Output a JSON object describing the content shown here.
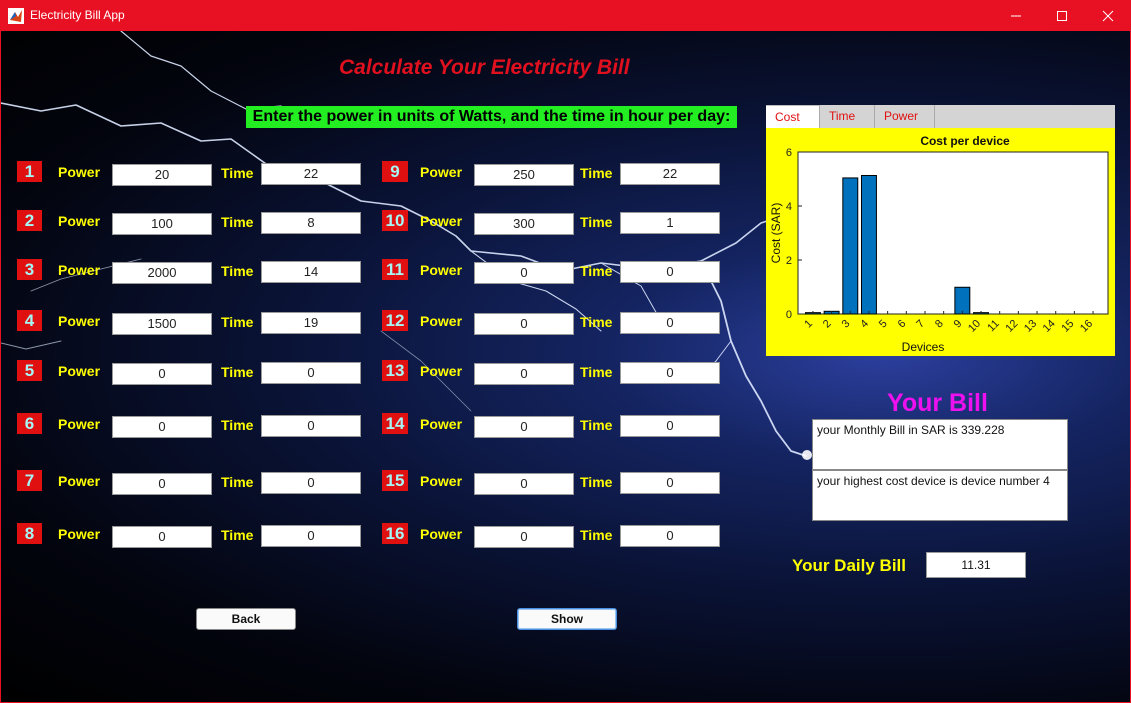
{
  "window": {
    "title": "Electricity Bill App"
  },
  "heading": "Calculate Your Electricity Bill",
  "instruction": "Enter the power in units of Watts, and the time in hour per day:",
  "labels": {
    "power": "Power",
    "time": "Time"
  },
  "devices": [
    {
      "num": "1",
      "power": "20",
      "time": "22"
    },
    {
      "num": "2",
      "power": "100",
      "time": "8"
    },
    {
      "num": "3",
      "power": "2000",
      "time": "14"
    },
    {
      "num": "4",
      "power": "1500",
      "time": "19"
    },
    {
      "num": "5",
      "power": "0",
      "time": "0"
    },
    {
      "num": "6",
      "power": "0",
      "time": "0"
    },
    {
      "num": "7",
      "power": "0",
      "time": "0"
    },
    {
      "num": "8",
      "power": "0",
      "time": "0"
    },
    {
      "num": "9",
      "power": "250",
      "time": "22"
    },
    {
      "num": "10",
      "power": "300",
      "time": "1"
    },
    {
      "num": "11",
      "power": "0",
      "time": "0"
    },
    {
      "num": "12",
      "power": "0",
      "time": "0"
    },
    {
      "num": "13",
      "power": "0",
      "time": "0"
    },
    {
      "num": "14",
      "power": "0",
      "time": "0"
    },
    {
      "num": "15",
      "power": "0",
      "time": "0"
    },
    {
      "num": "16",
      "power": "0",
      "time": "0"
    }
  ],
  "tabs": [
    "Cost",
    "Time",
    "Power"
  ],
  "chart_data": {
    "type": "bar",
    "title": "Cost per device",
    "xlabel": "Devices",
    "ylabel": "Cost (SAR)",
    "categories": [
      "1",
      "2",
      "3",
      "4",
      "5",
      "6",
      "7",
      "8",
      "9",
      "10",
      "11",
      "12",
      "13",
      "14",
      "15",
      "16"
    ],
    "values": [
      0.05,
      0.1,
      5.04,
      5.13,
      0,
      0,
      0,
      0,
      0.99,
      0.05,
      0,
      0,
      0,
      0,
      0,
      0
    ],
    "ylim": [
      0,
      6
    ],
    "yticks": [
      "0",
      "2",
      "4",
      "6"
    ],
    "bar_color": "#0072bd",
    "background": "#ffff00"
  },
  "bill": {
    "title": "Your Bill",
    "monthly_text": "your Monthly Bill in SAR is 339.228",
    "highest_text": "your highest cost device is device number 4",
    "daily_label": "Your Daily Bill",
    "daily_value": "11.31"
  },
  "buttons": {
    "back": "Back",
    "show": "Show"
  },
  "colors": {
    "titlebar": "#e81123",
    "accent_red": "#e01010",
    "label_yellow": "#ffff00",
    "instruction_green": "#22ee22",
    "bill_magenta": "#ee10ee"
  }
}
